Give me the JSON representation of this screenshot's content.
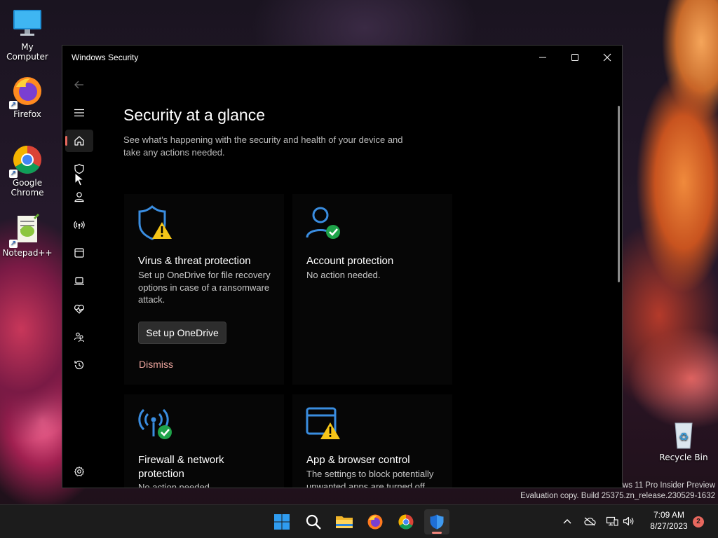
{
  "desktop": {
    "icons": [
      {
        "label": "My Computer"
      },
      {
        "label": "Firefox"
      },
      {
        "label": "Google Chrome"
      },
      {
        "label": "Notepad++"
      },
      {
        "label": "Recycle Bin"
      }
    ],
    "watermark": {
      "line1": "ws 11 Pro Insider Preview",
      "line2": "Evaluation copy. Build 25375.zn_release.230529-1632"
    }
  },
  "window": {
    "title": "Windows Security",
    "controls": {
      "minimize": "minimize-icon",
      "maximize": "maximize-icon",
      "close": "close-icon"
    }
  },
  "nav": {
    "items": [
      {
        "icon": "back-arrow-icon"
      },
      {
        "icon": "hamburger-menu-icon"
      },
      {
        "icon": "home-icon",
        "active": true
      },
      {
        "icon": "shield-icon"
      },
      {
        "icon": "person-icon"
      },
      {
        "icon": "wireless-antenna-icon"
      },
      {
        "icon": "app-browser-icon"
      },
      {
        "icon": "laptop-icon"
      },
      {
        "icon": "health-heart-icon"
      },
      {
        "icon": "family-icon"
      },
      {
        "icon": "history-icon"
      },
      {
        "icon": "settings-gear-icon"
      }
    ]
  },
  "main": {
    "title": "Security at a glance",
    "subtitle": "See what's happening with the security and health of your device and take any actions needed.",
    "cards": [
      {
        "title": "Virus & threat protection",
        "description": "Set up OneDrive for file recovery options in case of a ransomware attack.",
        "status": "warning",
        "action_button": "Set up OneDrive",
        "dismiss_link": "Dismiss"
      },
      {
        "title": "Account protection",
        "description": "No action needed.",
        "status": "ok"
      },
      {
        "title": "Firewall & network protection",
        "description": "No action needed.",
        "status": "ok"
      },
      {
        "title": "App & browser control",
        "description": "The settings to block potentially unwanted apps are turned off.",
        "status": "warning"
      }
    ]
  },
  "taskbar": {
    "apps": [
      {
        "icon": "windows-start-icon"
      },
      {
        "icon": "search-icon"
      },
      {
        "icon": "file-explorer-icon"
      },
      {
        "icon": "firefox-icon"
      },
      {
        "icon": "chrome-icon"
      },
      {
        "icon": "windows-security-icon",
        "active": true
      }
    ],
    "tray": {
      "chevron": "chevron-up-icon",
      "onedrive": "cloud-icon",
      "network": "network-icon",
      "volume": "volume-icon"
    },
    "clock": {
      "time": "7:09 AM",
      "date": "8/27/2023"
    },
    "notification_count": "2"
  },
  "colors": {
    "accent_blue": "#3a8de0",
    "warning_yellow": "#f5c518",
    "ok_green": "#1fa34a",
    "active_indicator": "#e8685e",
    "dismiss_link": "#f0a8a0"
  }
}
